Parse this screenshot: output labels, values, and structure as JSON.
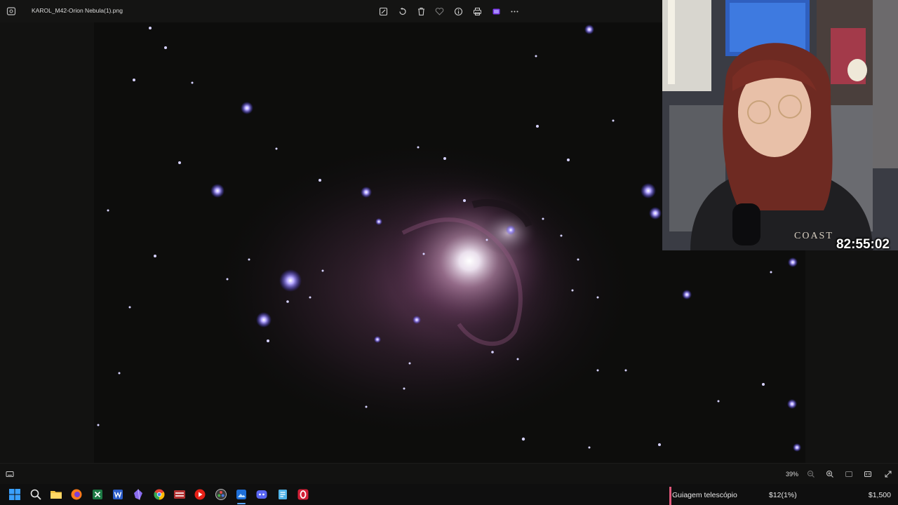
{
  "viewer": {
    "file_name": "KAROL_M42-Orion Nebula(1).png",
    "toolbar_icons": [
      "edit-image-icon",
      "rotate-icon",
      "delete-icon",
      "favorite-icon",
      "info-icon",
      "print-icon",
      "clipchamp-icon",
      "more-options-icon"
    ],
    "zoom_level": "39%"
  },
  "stream": {
    "timer": "82:55:02",
    "goal_label": "Guiagem telescópio",
    "goal_amount": "$12(1%)",
    "goal_target": "$1,500",
    "goal_progress_percent": 1,
    "goal_color": "#e0577a"
  },
  "taskbar": {
    "icons": [
      "windows-start-icon",
      "search-icon",
      "file-explorer-icon",
      "firefox-icon",
      "excel-icon",
      "word-icon",
      "obsidian-icon",
      "chrome-icon",
      "voicemeeter-icon",
      "youtube-music-icon",
      "davinci-resolve-icon",
      "photos-icon",
      "discord-icon",
      "notepad-icon",
      "opera-icon"
    ]
  }
}
